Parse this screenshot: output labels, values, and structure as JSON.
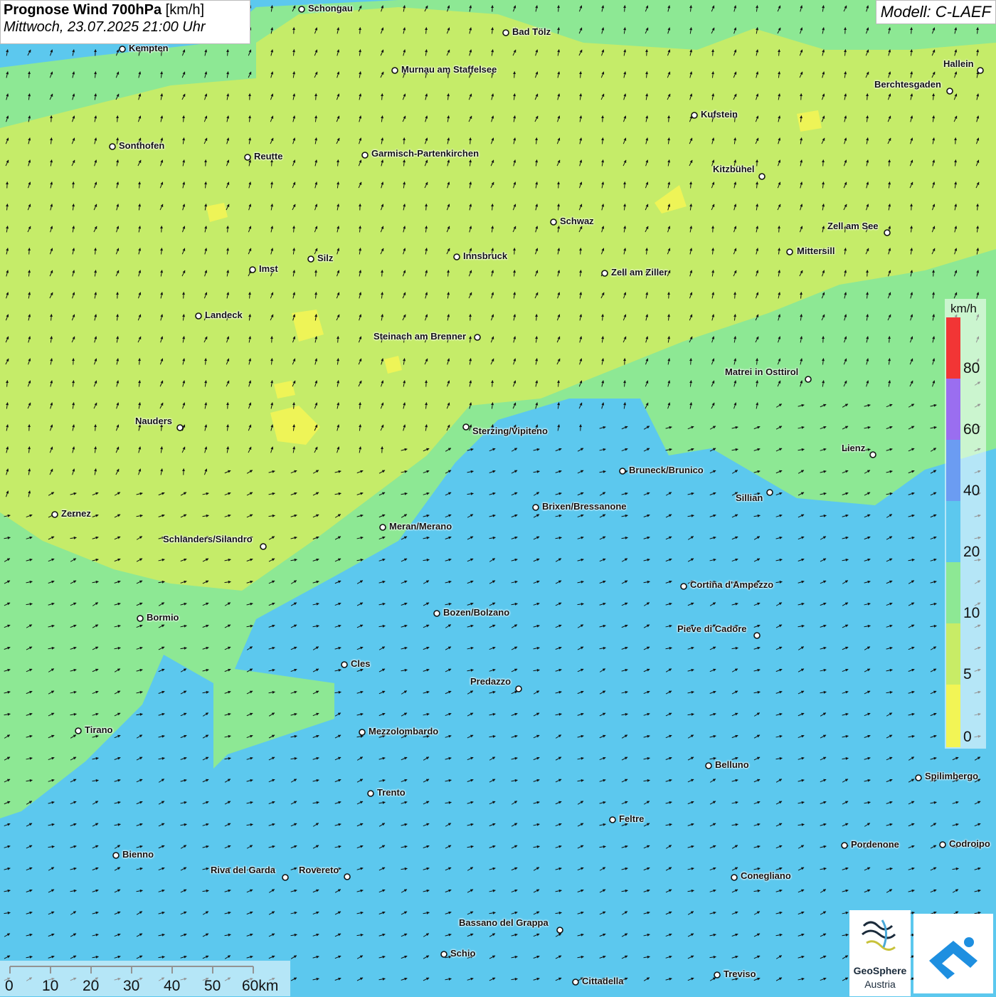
{
  "header": {
    "title": "Prognose Wind 700hPa",
    "unit": "[km/h]",
    "datetime": "Mittwoch, 23.07.2025 21:00 Uhr",
    "model": "Modell: C-LAEF"
  },
  "colors": {
    "band_0_5": "#f2f555",
    "band_5_10": "#c8ec66",
    "band_10_20": "#8de894",
    "band_20_40": "#5cc8ee",
    "band_40_60": "#6b9cf2",
    "band_60_80": "#9a6ef0",
    "band_80_plus": "#f23535"
  },
  "legend": {
    "unit": "km/h",
    "ticks": [
      "80",
      "60",
      "40",
      "20",
      "10",
      "5",
      "0"
    ]
  },
  "scale_bar": {
    "ticks": [
      "0",
      "10",
      "20",
      "30",
      "40",
      "50",
      "60km"
    ]
  },
  "cities": [
    {
      "name": "Schongau"
    },
    {
      "name": "Bad Tölz"
    },
    {
      "name": "Kempten"
    },
    {
      "name": "Murnau am Staffelsee"
    },
    {
      "name": "Hallein"
    },
    {
      "name": "Berchtesgaden"
    },
    {
      "name": "Kufstein"
    },
    {
      "name": "Sonthofen"
    },
    {
      "name": "Reutte"
    },
    {
      "name": "Garmisch-Partenkirchen"
    },
    {
      "name": "Kitzbühel"
    },
    {
      "name": "Schwaz"
    },
    {
      "name": "Zell am See"
    },
    {
      "name": "Mittersill"
    },
    {
      "name": "Innsbruck"
    },
    {
      "name": "Silz"
    },
    {
      "name": "Imst"
    },
    {
      "name": "Zell am Ziller"
    },
    {
      "name": "Landeck"
    },
    {
      "name": "Steinach am Brenner"
    },
    {
      "name": "Matrei in Osttirol"
    },
    {
      "name": "Nauders"
    },
    {
      "name": "Sterzing/Vipiteno"
    },
    {
      "name": "Lienz"
    },
    {
      "name": "Bruneck/Brunico"
    },
    {
      "name": "Sillian"
    },
    {
      "name": "Zernez"
    },
    {
      "name": "Brixen/Bressanone"
    },
    {
      "name": "Meran/Merano"
    },
    {
      "name": "Schlanders/Silandro"
    },
    {
      "name": "Cortina d'Ampezzo"
    },
    {
      "name": "Bozen/Bolzano"
    },
    {
      "name": "Bormio"
    },
    {
      "name": "Pieve di Cadore"
    },
    {
      "name": "Cles"
    },
    {
      "name": "Predazzo"
    },
    {
      "name": "Tirano"
    },
    {
      "name": "Mezzolombardo"
    },
    {
      "name": "Belluno"
    },
    {
      "name": "Spilimbergo"
    },
    {
      "name": "Trento"
    },
    {
      "name": "Feltre"
    },
    {
      "name": "Pordenone"
    },
    {
      "name": "Codroipo"
    },
    {
      "name": "Bienno"
    },
    {
      "name": "Riva del Garda"
    },
    {
      "name": "Rovereto"
    },
    {
      "name": "Conegliano"
    },
    {
      "name": "Bassano del Grappa"
    },
    {
      "name": "Schio"
    },
    {
      "name": "Treviso"
    },
    {
      "name": "Cittadella"
    }
  ],
  "logos": {
    "geosphere_name": "GeoSphere",
    "geosphere_sub": "Austria",
    "geosphere_icon": "geosphere-logo-icon",
    "app_icon": "weather-app-logo-icon"
  }
}
